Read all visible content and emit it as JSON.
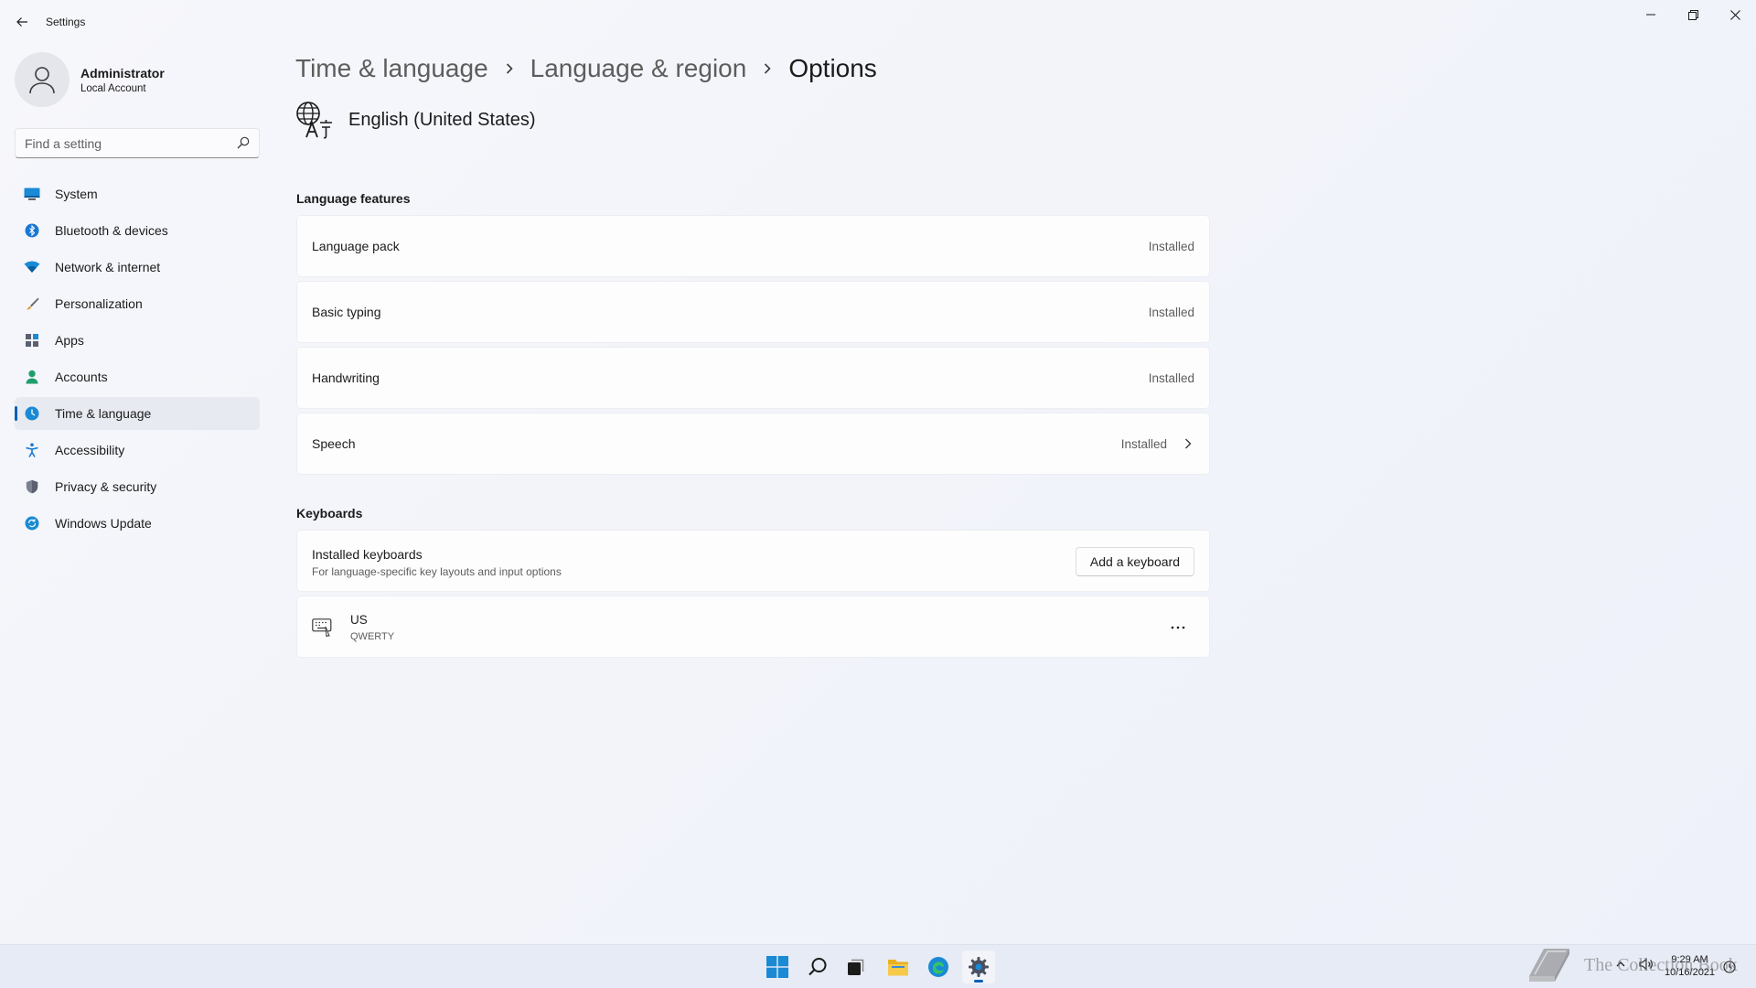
{
  "window": {
    "title": "Settings"
  },
  "profile": {
    "name": "Administrator",
    "account_type": "Local Account"
  },
  "search": {
    "placeholder": "Find a setting"
  },
  "sidebar": {
    "items": [
      {
        "label": "System",
        "icon": "monitor-icon",
        "active": false
      },
      {
        "label": "Bluetooth & devices",
        "icon": "bluetooth-icon",
        "active": false
      },
      {
        "label": "Network & internet",
        "icon": "wifi-icon",
        "active": false
      },
      {
        "label": "Personalization",
        "icon": "brush-icon",
        "active": false
      },
      {
        "label": "Apps",
        "icon": "apps-icon",
        "active": false
      },
      {
        "label": "Accounts",
        "icon": "person-icon",
        "active": false
      },
      {
        "label": "Time & language",
        "icon": "globe-clock-icon",
        "active": true
      },
      {
        "label": "Accessibility",
        "icon": "accessibility-icon",
        "active": false
      },
      {
        "label": "Privacy & security",
        "icon": "shield-icon",
        "active": false
      },
      {
        "label": "Windows Update",
        "icon": "update-icon",
        "active": false
      }
    ]
  },
  "breadcrumb": {
    "items": [
      "Time & language",
      "Language & region"
    ],
    "current": "Options"
  },
  "language": {
    "name": "English (United States)"
  },
  "features": {
    "title": "Language features",
    "items": [
      {
        "label": "Language pack",
        "status": "Installed"
      },
      {
        "label": "Basic typing",
        "status": "Installed"
      },
      {
        "label": "Handwriting",
        "status": "Installed"
      },
      {
        "label": "Speech",
        "status": "Installed"
      }
    ]
  },
  "keyboards": {
    "title": "Keyboards",
    "installed_title": "Installed keyboards",
    "installed_desc": "For language-specific key layouts and input options",
    "add_button": "Add a keyboard",
    "items": [
      {
        "name": "US",
        "layout": "QWERTY"
      }
    ]
  },
  "taskbar": {
    "time": "9:29 AM",
    "date": "10/16/2021",
    "watermark": "The Collection Book"
  },
  "colors": {
    "accent": "#005fb8",
    "background": "#f3f5fb"
  }
}
